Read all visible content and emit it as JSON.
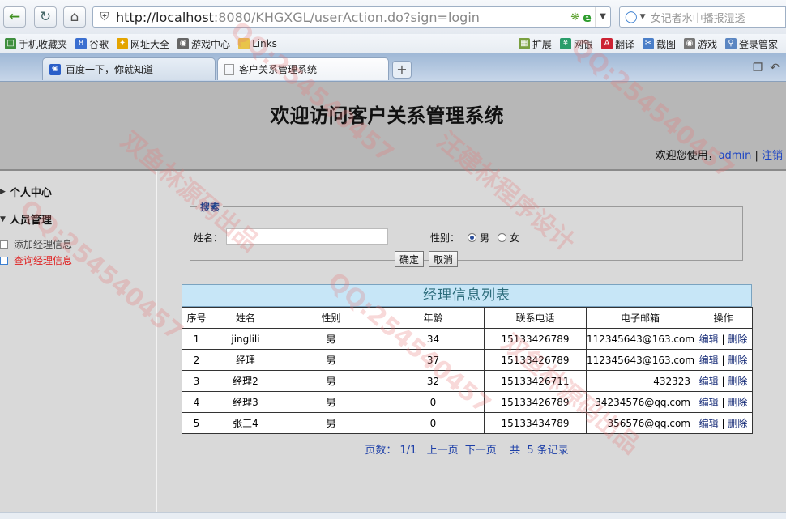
{
  "browser": {
    "url_host": "http://localhost",
    "url_rest": ":8080/KHGXGL/userAction.do?sign=login",
    "search_placeholder": "女记者水中播报湿透",
    "bookmarks": [
      "手机收藏夹",
      "谷歌",
      "网址大全",
      "游戏中心",
      "Links"
    ],
    "toolbar_right": [
      "扩展",
      "网银",
      "翻译",
      "截图",
      "游戏",
      "登录管家"
    ],
    "tabs": [
      {
        "label": "百度一下，你就知道",
        "active": false
      },
      {
        "label": "客户关系管理系统",
        "active": true
      }
    ]
  },
  "header": {
    "title": "欢迎访问客户关系管理系统",
    "welcome_prefix": "欢迎您使用，",
    "user": "admin",
    "separator": "|",
    "logout": "注销"
  },
  "sidebar": {
    "personal_center": "个人中心",
    "staff_management": "人员管理",
    "items": [
      {
        "label": "添加经理信息",
        "active": false
      },
      {
        "label": "查询经理信息",
        "active": true
      }
    ]
  },
  "search": {
    "legend": "搜索",
    "name_label": "姓名：",
    "name_value": "",
    "gender_label": "性别：",
    "gender_options": [
      "男",
      "女"
    ],
    "gender_selected": "男",
    "confirm": "确定",
    "cancel": "取消"
  },
  "list": {
    "title": "经理信息列表",
    "columns": [
      "序号",
      "姓名",
      "性别",
      "年龄",
      "联系电话",
      "电子邮箱",
      "操作"
    ],
    "rows": [
      {
        "no": "1",
        "name": "jinglili",
        "gender": "男",
        "age": "34",
        "phone": "15133426789",
        "email": "112345643@163.com"
      },
      {
        "no": "2",
        "name": "经理",
        "gender": "男",
        "age": "37",
        "phone": "15133426789",
        "email": "112345643@163.com"
      },
      {
        "no": "3",
        "name": "经理2",
        "gender": "男",
        "age": "32",
        "phone": "15133426711",
        "email": "432323"
      },
      {
        "no": "4",
        "name": "经理3",
        "gender": "男",
        "age": "0",
        "phone": "15133426789",
        "email": "34234576@qq.com"
      },
      {
        "no": "5",
        "name": "张三4",
        "gender": "男",
        "age": "0",
        "phone": "15133434789",
        "email": "356576@qq.com"
      }
    ],
    "edit": "编辑",
    "op_sep": "|",
    "delete": "删除"
  },
  "pager": {
    "pages_label": "页数：",
    "pages": "1/1",
    "prev": "上一页",
    "next": "下一页",
    "total_prefix": "共",
    "total": "5",
    "total_suffix": "条记录"
  },
  "watermark": [
    "QQ:254540457",
    "双鱼林源码出品",
    "汪建林程序设计"
  ]
}
